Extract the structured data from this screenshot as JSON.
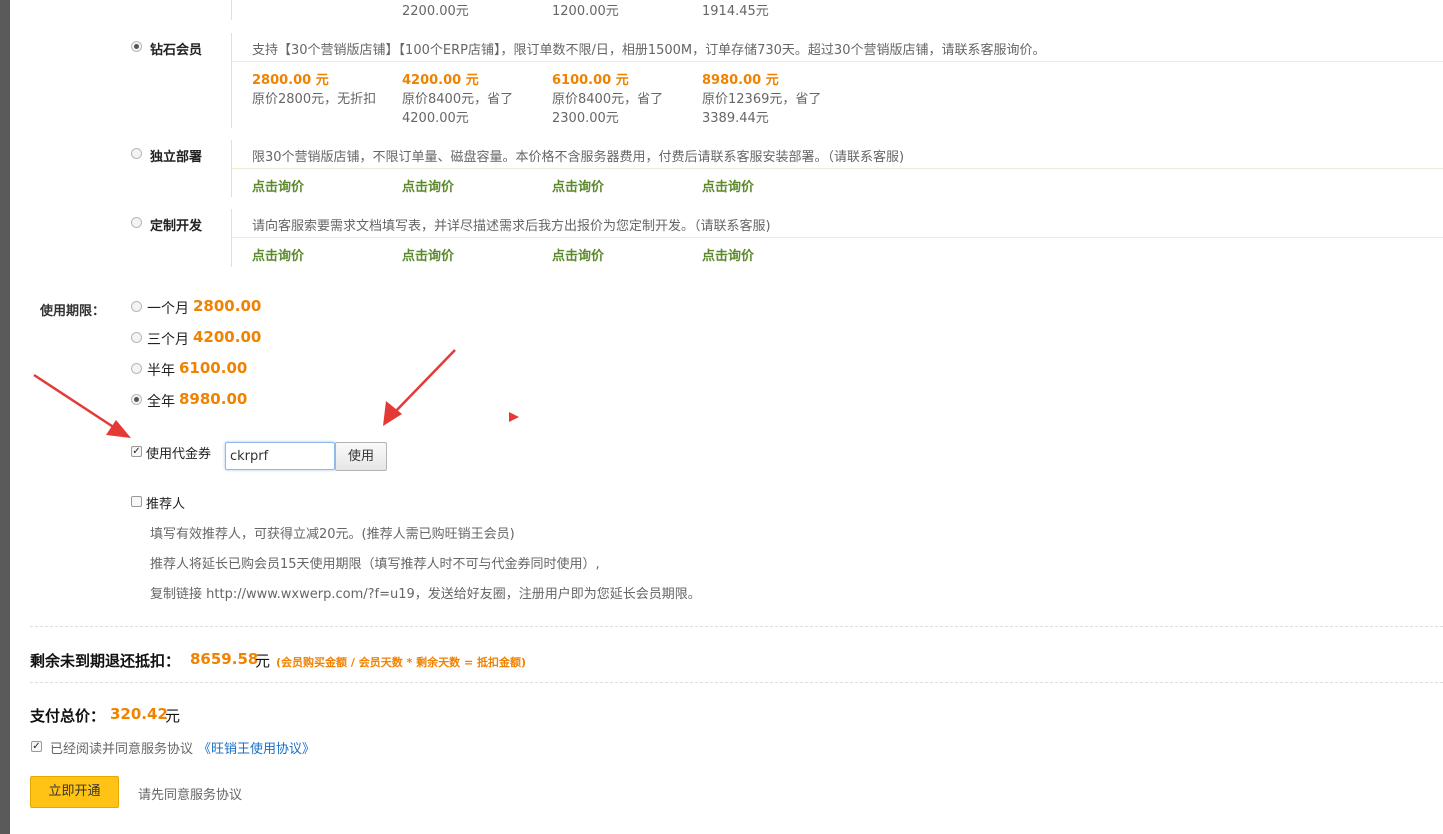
{
  "top_row": [
    "2200.00元",
    "1200.00元",
    "1914.45元"
  ],
  "plans": [
    {
      "name": "钻石会员",
      "selected": true,
      "desc": "支持【30个营销版店铺】【100个ERP店铺】，限订单数不限/日，相册1500M，订单存储730天。超过30个营销版店铺，请联系客服询价。",
      "prices": [
        {
          "price": "2800.00 元",
          "line1": "原价2800元，无折扣",
          "line2": ""
        },
        {
          "price": "4200.00 元",
          "line1": "原价8400元，省了",
          "line2": "4200.00元"
        },
        {
          "price": "6100.00 元",
          "line1": "原价8400元，省了",
          "line2": "2300.00元"
        },
        {
          "price": "8980.00 元",
          "line1": "原价12369元，省了",
          "line2": "3389.44元"
        }
      ]
    },
    {
      "name": "独立部署",
      "selected": false,
      "desc": "限30个营销版店铺，不限订单量、磁盘容量。本价格不含服务器费用，付费后请联系客服安装部署。（请联系客服)",
      "inquire": [
        "点击询价",
        "点击询价",
        "点击询价",
        "点击询价"
      ]
    },
    {
      "name": "定制开发",
      "selected": false,
      "desc": "请向客服索要需求文档填写表，并详尽描述需求后我方出报价为您定制开发。（请联系客服)",
      "inquire": [
        "点击询价",
        "点击询价",
        "点击询价",
        "点击询价"
      ]
    }
  ],
  "period": {
    "label": "使用期限：",
    "options": [
      {
        "name": "一个月",
        "price": "2800.00",
        "selected": false
      },
      {
        "name": "三个月",
        "price": "4200.00",
        "selected": false
      },
      {
        "name": "半年",
        "price": "6100.00",
        "selected": false
      },
      {
        "name": "全年",
        "price": "8980.00",
        "selected": true
      }
    ]
  },
  "coupon": {
    "checked": true,
    "label": "使用代金券",
    "value": "ckrprf",
    "button": "使用"
  },
  "referrer": {
    "checked": false,
    "label": "推荐人",
    "notes": [
      "填写有效推荐人，可获得立减20元。(推荐人需已购旺销王会员)",
      "推荐人将延长已购会员15天使用期限（填写推荐人时不可与代金券同时使用）,",
      "复制链接 http://www.wxwerp.com/?f=u19，发送给好友圈，注册用户即为您延长会员期限。"
    ]
  },
  "refund": {
    "label": "剩余未到期退还抵扣：",
    "amount": "8659.58",
    "unit": "元",
    "formula": "(会员购买金额 / 会员天数 * 剩余天数 = 抵扣金额)"
  },
  "total": {
    "label": "支付总价：",
    "amount": "320.42",
    "unit": "元"
  },
  "agreement": {
    "checked": true,
    "text": "已经阅读并同意服务协议",
    "link": "《旺销王使用协议》"
  },
  "open_button": "立即开通",
  "hint": "请先同意服务协议",
  "colors": {
    "accent_orange": "#f08200",
    "green": "#5b8a2b",
    "button_yellow": "#ffc316",
    "arrow_red": "#e53935"
  }
}
